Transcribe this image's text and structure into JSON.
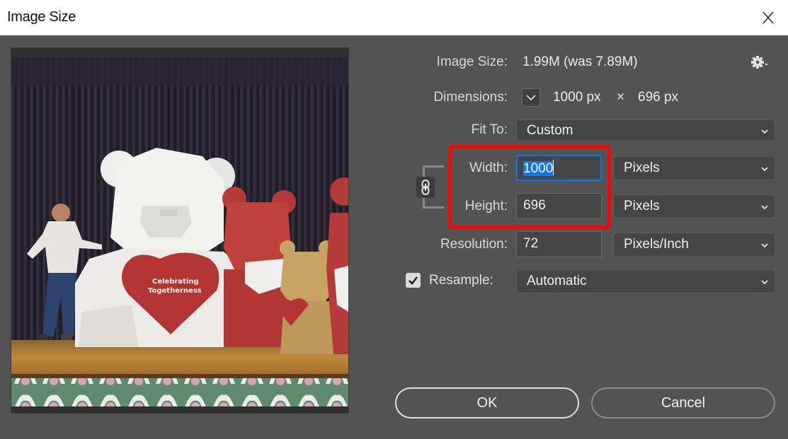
{
  "window": {
    "title": "Image Size",
    "close_icon": "close-icon"
  },
  "preview": {
    "description": "Stage photo with white, red and tan low-poly teddy bears and a man leaning on the white bear",
    "heart_text_line1": "Celebrating",
    "heart_text_line2": "Togetherness"
  },
  "info": {
    "image_size_label": "Image Size:",
    "image_size_value": "1.99M (was 7.89M)",
    "settings_icon": "gear-icon",
    "dimensions_label": "Dimensions:",
    "dimensions_width": "1000 px",
    "dimensions_times": "×",
    "dimensions_height": "696 px"
  },
  "form": {
    "fit_to_label": "Fit To:",
    "fit_to_value": "Custom",
    "width_label": "Width:",
    "width_value": "1000",
    "width_unit": "Pixels",
    "height_label": "Height:",
    "height_value": "696",
    "height_unit": "Pixels",
    "resolution_label": "Resolution:",
    "resolution_value": "72",
    "resolution_unit": "Pixels/Inch",
    "resample_label": "Resample:",
    "resample_checked": true,
    "resample_value": "Automatic",
    "constrain_proportions_icon": "link-icon"
  },
  "highlight": {
    "color": "#ff0000",
    "target": "width-and-height-fields"
  },
  "buttons": {
    "ok_label": "OK",
    "cancel_label": "Cancel"
  },
  "colors": {
    "panel_bg": "#535353",
    "focus_accent": "#1473e6",
    "titlebar_bg": "#ffffff"
  }
}
